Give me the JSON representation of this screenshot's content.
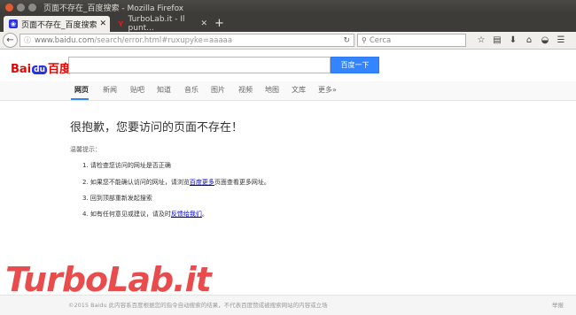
{
  "window": {
    "title": "页面不存在_百度搜索 - Mozilla Firefox"
  },
  "tabs": [
    {
      "label": "页面不存在_百度搜索",
      "icon": "baidu-paw-icon",
      "active": true
    },
    {
      "label": "TurboLab.it - Il punt...",
      "icon": "turbolab-icon",
      "active": false
    }
  ],
  "toolbar": {
    "url_host": "www.baidu.com",
    "url_path": "/search/error.html#ruxupyke=aaaaa",
    "search_placeholder": "Cerca"
  },
  "page": {
    "logo_bai": "Bai",
    "logo_du": "du",
    "logo_cn": "百度",
    "search_button": "百度一下",
    "nav": [
      "网页",
      "新闻",
      "贴吧",
      "知道",
      "音乐",
      "图片",
      "视频",
      "地图",
      "文库",
      "更多»"
    ],
    "heading": "很抱歉，您要访问的页面不存在！",
    "hint": "温馨提示：",
    "items": {
      "i1": "1. 请检查您访问的网址是否正确",
      "i2_pre": "2. 如果您不能确认访问的网址，请浏览",
      "i2_link": "百度更多",
      "i2_post": "页面查看更多网址。",
      "i3": "3. 回到顶部重新发起搜索",
      "i4_pre": "4. 如有任何意见或建议，请及时",
      "i4_link": "反馈给我们",
      "i4_post": "。"
    },
    "footer_copy": "©2015 Baidu 此内容系百度根据您的指令自动搜索的结果，不代表百度赞成被搜索网站的内容或立场",
    "footer_report": "举报"
  },
  "watermark": "TurboLab.it",
  "colors": {
    "baidu_red": "#e10602",
    "baidu_blue": "#3385ff",
    "link": "#0000cc"
  }
}
